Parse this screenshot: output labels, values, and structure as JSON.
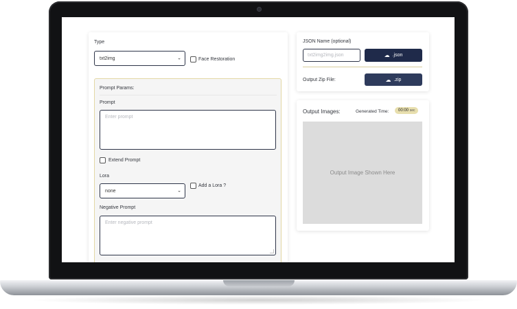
{
  "left_panel": {
    "type_label": "Type",
    "type_select": {
      "value": "txt2img"
    },
    "face_restoration_label": "Face Restoration",
    "params": {
      "title": "Prompt Params:",
      "prompt_label": "Prompt",
      "prompt_placeholder": "Enter prompt",
      "extend_prompt_label": "Extend Prompt",
      "lora_label": "Lora",
      "lora_select": {
        "value": "none"
      },
      "add_lora_label": "Add a Lora ?",
      "negative_prompt_label": "Negative Prompt",
      "negative_prompt_placeholder": "Enter negative prompt"
    }
  },
  "json_panel": {
    "json_name_label": "JSON Name (optional)",
    "json_name_placeholder": "txt2img2img.json",
    "json_button_label": ".json",
    "output_zip_label": "Output Zip File:",
    "zip_button_label": ".zip"
  },
  "output_panel": {
    "title": "Output Images:",
    "generated_time_label": "Generated Time:",
    "generated_time_value": "00:00",
    "generated_time_unit": "sec",
    "placeholder_text": "Output Image Shown Here"
  },
  "colors": {
    "primary_button": "#1f2a4a",
    "accent_border": "#e3d7a4",
    "time_badge": "#e8dfae"
  }
}
